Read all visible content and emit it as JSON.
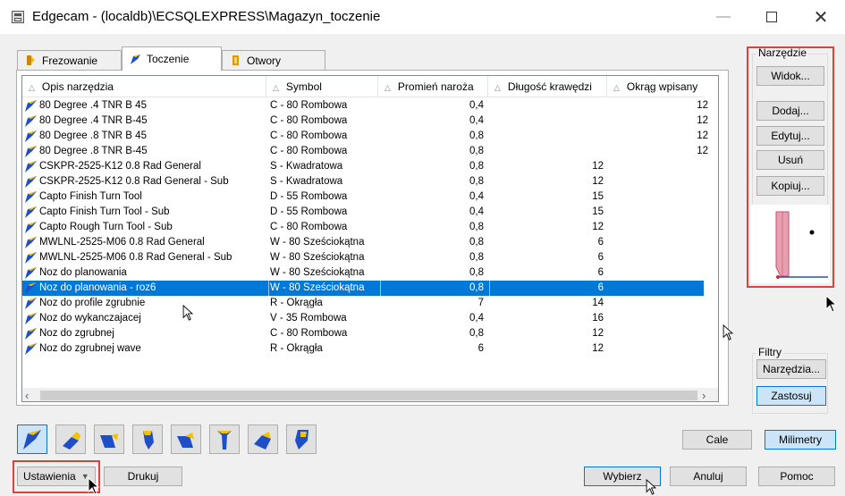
{
  "window": {
    "title": "Edgecam - (localdb)\\ECSQLEXPRESS\\Magazyn_toczenie",
    "minimize": "—",
    "close": "✕"
  },
  "tabs": [
    {
      "label": "Frezowanie",
      "active": false
    },
    {
      "label": "Toczenie",
      "active": true
    },
    {
      "label": "Otwory",
      "active": false
    }
  ],
  "table": {
    "headers": [
      "Opis narzędzia",
      "Symbol",
      "Promień naroża",
      "Długość krawędzi",
      "Okrąg wpisany"
    ],
    "rows": [
      [
        "80 Degree .4 TNR B 45",
        "C - 80 Rombowa",
        "0,4",
        "",
        "12"
      ],
      [
        "80 Degree .4 TNR B-45",
        "C - 80 Rombowa",
        "0,4",
        "",
        "12"
      ],
      [
        "80 Degree .8 TNR B 45",
        "C - 80 Rombowa",
        "0,8",
        "",
        "12"
      ],
      [
        "80 Degree .8 TNR B-45",
        "C - 80 Rombowa",
        "0,8",
        "",
        "12"
      ],
      [
        "CSKPR-2525-K12 0.8 Rad General",
        "S - Kwadratowa",
        "0,8",
        "12",
        ""
      ],
      [
        "CSKPR-2525-K12 0.8 Rad General - Sub",
        "S - Kwadratowa",
        "0,8",
        "12",
        ""
      ],
      [
        "Capto Finish Turn Tool",
        "D - 55 Rombowa",
        "0,4",
        "15",
        ""
      ],
      [
        "Capto Finish Turn Tool - Sub",
        "D - 55 Rombowa",
        "0,4",
        "15",
        ""
      ],
      [
        "Capto Rough Turn Tool - Sub",
        "C - 80 Rombowa",
        "0,8",
        "12",
        ""
      ],
      [
        "MWLNL-2525-M06 0.8 Rad General",
        "W - 80 Sześciokątna",
        "0,8",
        "6",
        ""
      ],
      [
        "MWLNL-2525-M06 0.8 Rad General - Sub",
        "W - 80 Sześciokątna",
        "0,8",
        "6",
        ""
      ],
      [
        "Noz do planowania",
        "W - 80 Sześciokątna",
        "0,8",
        "6",
        ""
      ],
      [
        "Noz do planowania - roz6",
        "W - 80 Sześciokątna",
        "0,8",
        "6",
        ""
      ],
      [
        "Noz do profile zgrubnie",
        "R - Okrągła",
        "7",
        "14",
        ""
      ],
      [
        "Noz do wykanczajacej",
        "V - 35 Rombowa",
        "0,4",
        "16",
        ""
      ],
      [
        "Noz do zgrubnej",
        "C - 80 Rombowa",
        "0,8",
        "12",
        ""
      ],
      [
        "Noz do zgrubnej wave",
        "R - Okrągła",
        "6",
        "12",
        ""
      ]
    ],
    "selected_row": 12
  },
  "narzedzie_group": {
    "label": "Narzędzie",
    "widok": "Widok...",
    "dodaj": "Dodaj...",
    "edytuj": "Edytuj...",
    "usun": "Usuń",
    "kopiuj": "Kopiuj..."
  },
  "filtry_group": {
    "label": "Filtry",
    "narzedzia": "Narzędzia...",
    "zastosuj": "Zastosuj"
  },
  "units": {
    "cale": "Cale",
    "milimetry": "Milimetry"
  },
  "bottom": {
    "ustawienia": "Ustawienia",
    "drukuj": "Drukuj",
    "wybierz": "Wybierz",
    "anuluj": "Anuluj",
    "pomoc": "Pomoc"
  },
  "colors": {
    "selection": "#0078d7",
    "highlight_box": "#e0403e",
    "active_button": "#cce4f7",
    "insert_blue": "#1f4fc8",
    "insert_yellow": "#f2c200"
  },
  "toolbar_icons": [
    "turn-general-icon",
    "turn-thread-icon",
    "turn-groove-icon",
    "turn-parting-icon",
    "turn-bore-groove-icon",
    "turn-drill-icon",
    "turn-form-icon",
    "turn-custom-icon"
  ]
}
